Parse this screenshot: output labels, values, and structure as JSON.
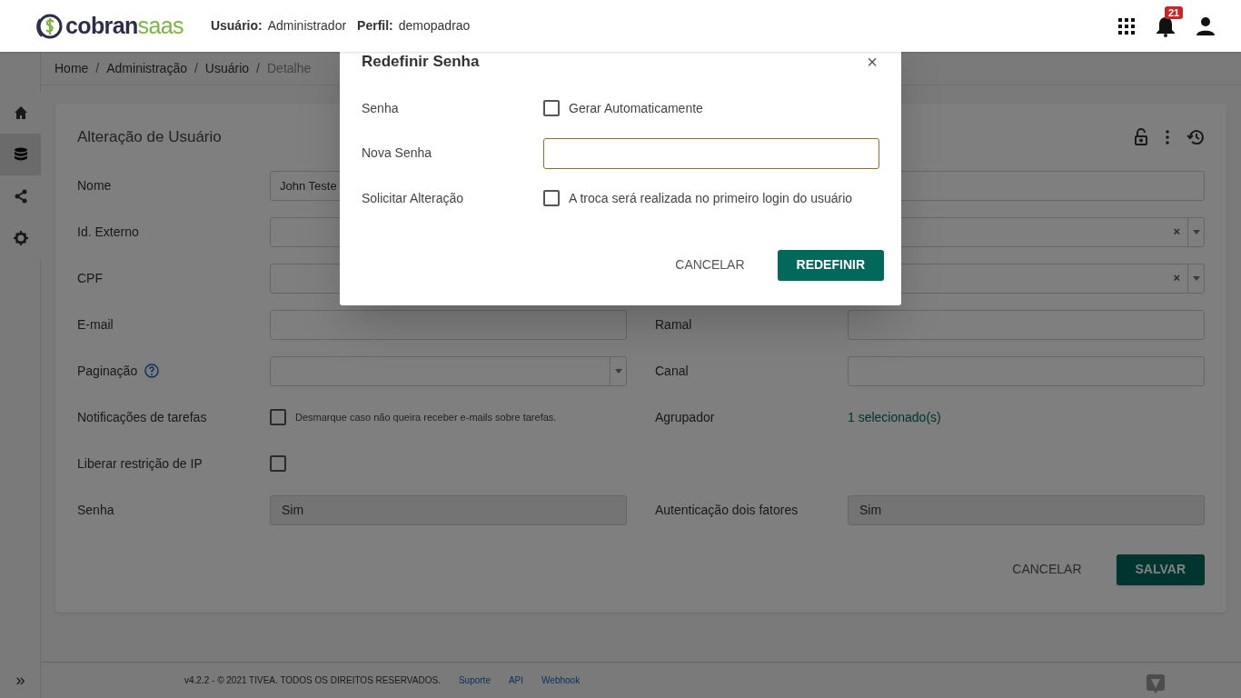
{
  "header": {
    "logo": [
      "cobran",
      "saas"
    ],
    "user_label": "Usuário:",
    "user": "Administrador",
    "profile_label": "Perfil:",
    "profile": "demopadrao",
    "notification_count": "21"
  },
  "breadcrumb": [
    {
      "label": "Home",
      "separator": "/"
    },
    {
      "label": "Administração",
      "separator": "/"
    },
    {
      "label": "Usuário",
      "separator": "/"
    },
    {
      "label": "Detalhe"
    }
  ],
  "sidebar": {
    "items": [
      {
        "selected": false
      },
      {
        "selected": true
      },
      {
        "selected": false
      },
      {
        "selected": false
      }
    ]
  },
  "form": {
    "title": "Alteração de Usuário",
    "rows": [
      {
        "left": {
          "label": "Nome",
          "kind": "text",
          "value": "John Teste"
        },
        "right": {
          "kind": "text"
        }
      },
      {
        "left": {
          "label": "Id. Externo",
          "kind": "text"
        },
        "right": {
          "kind": "select-clear",
          "clear": "×"
        }
      },
      {
        "left": {
          "label": "CPF",
          "kind": "text"
        },
        "right": {
          "kind": "select-clear",
          "clear": "×"
        }
      },
      {
        "left": {
          "label": "E-mail",
          "kind": "text"
        },
        "right": {
          "label": "Ramal",
          "kind": "text"
        }
      },
      {
        "left": {
          "label": "Paginação",
          "help": true,
          "kind": "select"
        },
        "right": {
          "label": "Canal",
          "kind": "text"
        }
      },
      {
        "left": {
          "label": "Notificações de tarefas",
          "kind": "checkbox",
          "checked": false,
          "text": "Desmarque caso não queira receber e-mails sobre tarefas."
        },
        "right": {
          "label": "Agrupador",
          "kind": "link",
          "value": "1 selecionado(s)"
        }
      },
      {
        "left": {
          "label": "Liberar restrição de IP",
          "kind": "checkbox",
          "checked": false
        }
      },
      {
        "left": {
          "label": "Senha",
          "kind": "readonly",
          "value": "Sim"
        },
        "right": {
          "label": "Autenticação dois fatores",
          "kind": "readonly",
          "value": "Sim"
        }
      }
    ],
    "buttons": [
      {
        "label": "CANCELAR",
        "kind": "flat"
      },
      {
        "label": "SALVAR",
        "kind": "primary"
      }
    ]
  },
  "footer": {
    "text": "v4.2.2 - © 2021 TIVEA. TODOS OS DIREITOS RESERVADOS.",
    "links": [
      "Suporte",
      "API",
      "Webhook"
    ],
    "expand": "»"
  },
  "dialog": {
    "title": "Redefinir Senha",
    "close": "×",
    "rows": [
      {
        "label": "Senha",
        "kind": "checkbox",
        "checked": false,
        "text": "Gerar Automaticamente"
      },
      {
        "label": "Nova Senha",
        "kind": "password"
      },
      {
        "label": "Solicitar Alteração",
        "kind": "checkbox",
        "checked": false,
        "text": "A troca será realizada no primeiro login do usuário"
      }
    ],
    "buttons": [
      {
        "label": "CANCELAR",
        "kind": "flat"
      },
      {
        "label": "REDEFINIR",
        "kind": "primary"
      }
    ]
  }
}
